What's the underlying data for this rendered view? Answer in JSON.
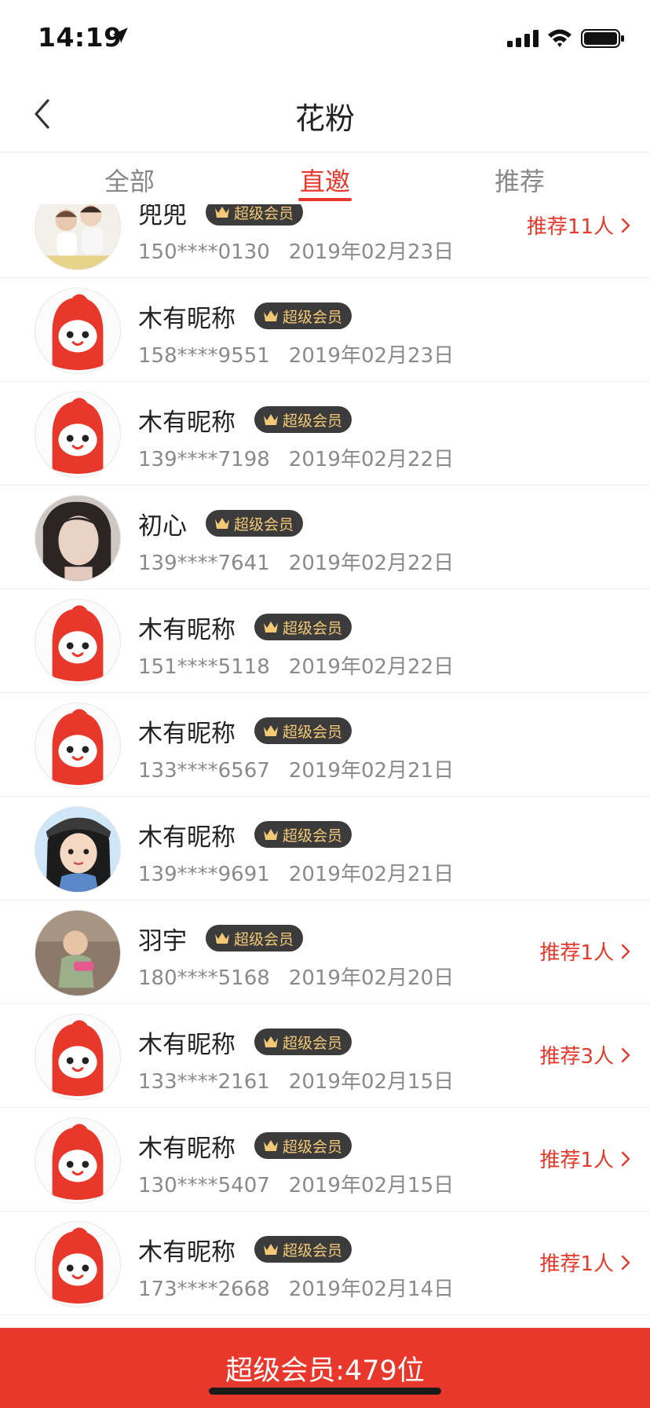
{
  "status_bar": {
    "time": "14:19"
  },
  "nav": {
    "title": "花粉"
  },
  "tabs": [
    {
      "label": "全部",
      "active": false
    },
    {
      "label": "直邀",
      "active": true
    },
    {
      "label": "推荐",
      "active": false
    }
  ],
  "colors": {
    "accent": "#e8382b",
    "badge_bg": "#3b3b3b",
    "badge_text": "#f3c977"
  },
  "members": [
    {
      "name": "兜兜",
      "badge": "超级会员",
      "phone": "150****0130",
      "date": "2019年02月23日",
      "recommend": "推荐11人",
      "avatar": "kids-photo"
    },
    {
      "name": "木有昵称",
      "badge": "超级会员",
      "phone": "158****9551",
      "date": "2019年02月23日",
      "recommend": "",
      "avatar": "default-mascot"
    },
    {
      "name": "木有昵称",
      "badge": "超级会员",
      "phone": "139****7198",
      "date": "2019年02月22日",
      "recommend": "",
      "avatar": "default-mascot"
    },
    {
      "name": "初心",
      "badge": "超级会员",
      "phone": "139****7641",
      "date": "2019年02月22日",
      "recommend": "",
      "avatar": "woman-photo"
    },
    {
      "name": "木有昵称",
      "badge": "超级会员",
      "phone": "151****5118",
      "date": "2019年02月22日",
      "recommend": "",
      "avatar": "default-mascot"
    },
    {
      "name": "木有昵称",
      "badge": "超级会员",
      "phone": "133****6567",
      "date": "2019年02月21日",
      "recommend": "",
      "avatar": "default-mascot"
    },
    {
      "name": "木有昵称",
      "badge": "超级会员",
      "phone": "139****9691",
      "date": "2019年02月21日",
      "recommend": "",
      "avatar": "cartoon-girl"
    },
    {
      "name": "羽宇",
      "badge": "超级会员",
      "phone": "180****5168",
      "date": "2019年02月20日",
      "recommend": "推荐1人",
      "avatar": "baby-photo"
    },
    {
      "name": "木有昵称",
      "badge": "超级会员",
      "phone": "133****2161",
      "date": "2019年02月15日",
      "recommend": "推荐3人",
      "avatar": "default-mascot"
    },
    {
      "name": "木有昵称",
      "badge": "超级会员",
      "phone": "130****5407",
      "date": "2019年02月15日",
      "recommend": "推荐1人",
      "avatar": "default-mascot"
    },
    {
      "name": "木有昵称",
      "badge": "超级会员",
      "phone": "173****2668",
      "date": "2019年02月14日",
      "recommend": "推荐1人",
      "avatar": "default-mascot"
    }
  ],
  "footer": {
    "summary": "超级会员:479位"
  }
}
